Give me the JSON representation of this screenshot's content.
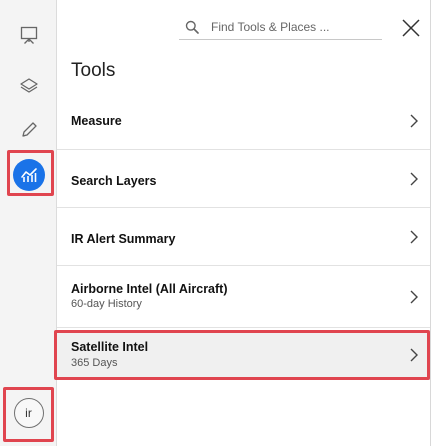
{
  "panel": {
    "title": "Tools",
    "search_placeholder": "Find Tools & Places ...",
    "items": [
      {
        "label": "Measure",
        "sub": ""
      },
      {
        "label": "Search Layers",
        "sub": ""
      },
      {
        "label": "IR Alert Summary",
        "sub": ""
      },
      {
        "label": "Airborne Intel (All Aircraft)",
        "sub": "60-day History"
      },
      {
        "label": "Satellite Intel",
        "sub": "365 Days"
      }
    ]
  },
  "rail": {
    "avatar_initials": "ir",
    "items": [
      "presentation-icon",
      "layers-icon",
      "pencil-icon",
      "tools-icon"
    ]
  },
  "colors": {
    "accent": "#1a73e8",
    "highlight": "#e0454f"
  }
}
